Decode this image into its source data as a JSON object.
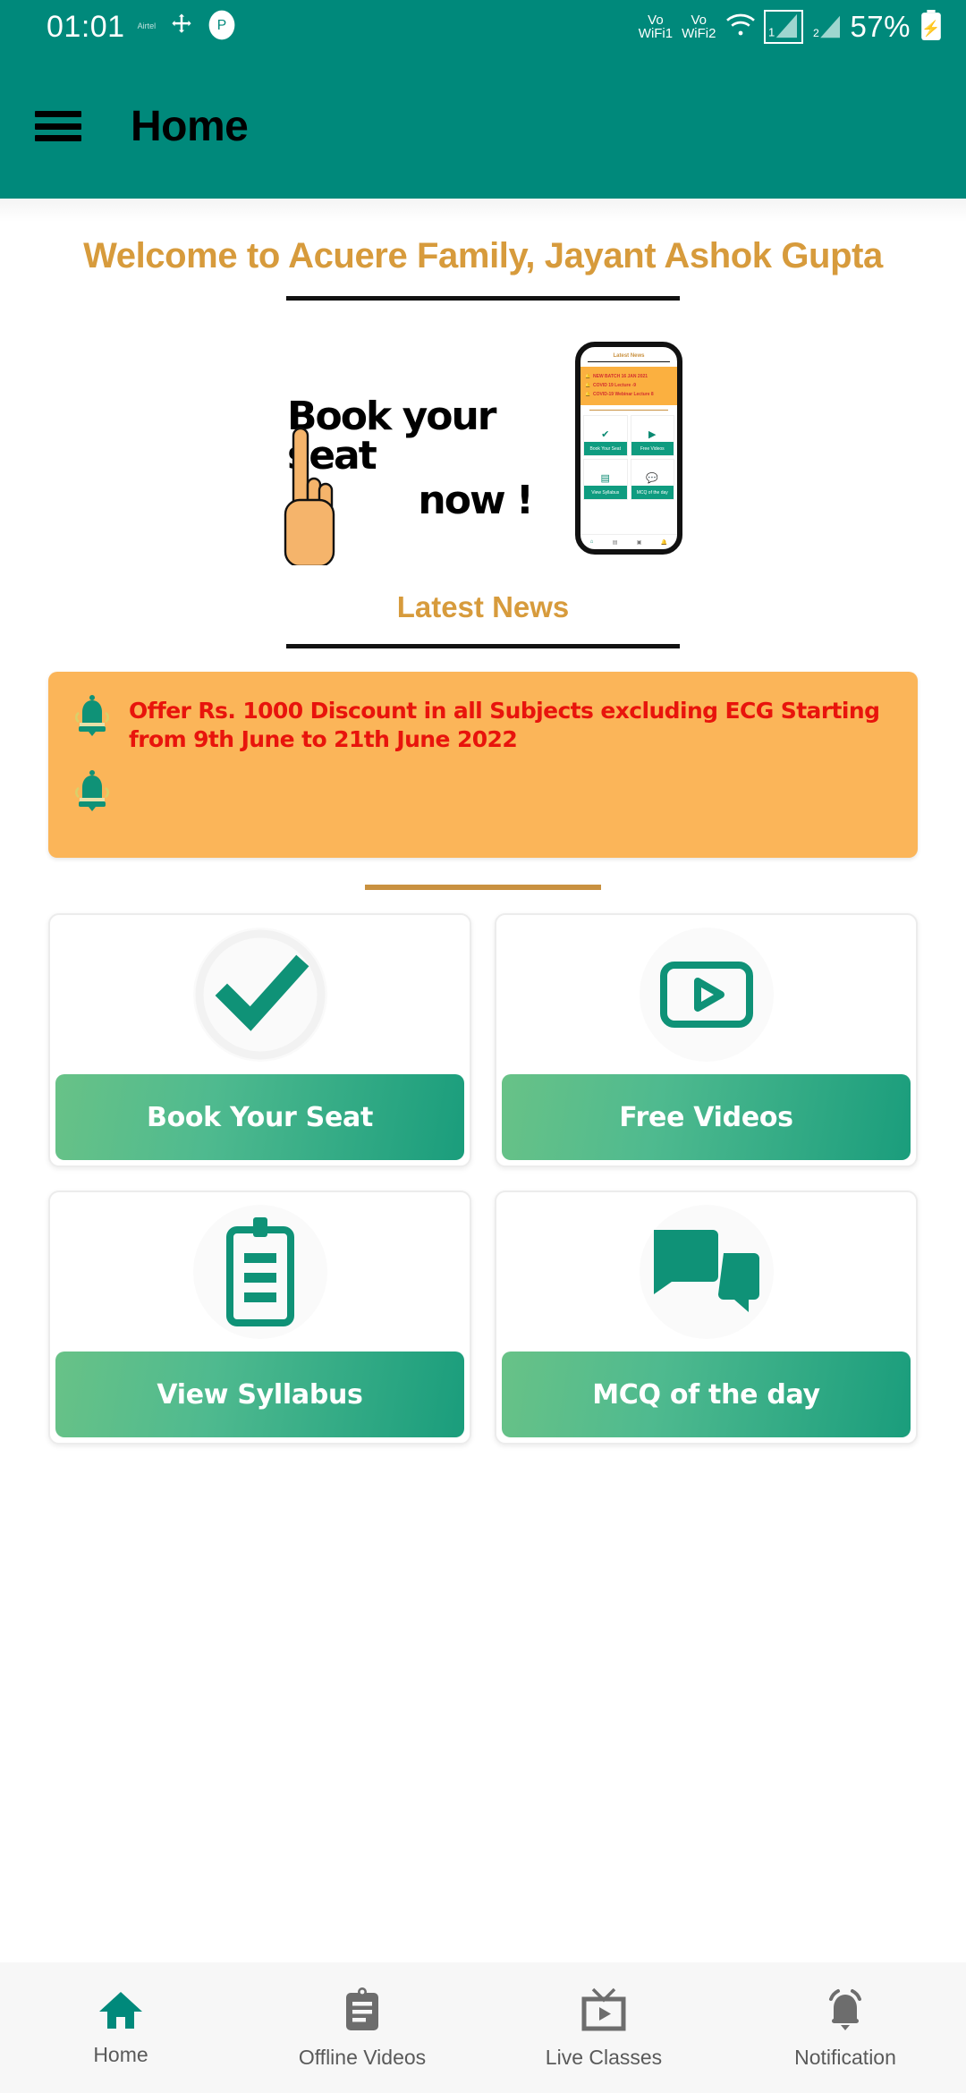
{
  "statusbar": {
    "time": "01:01",
    "carrier_badge": "Airtel",
    "vowifi1": "Vo\nWiFi1",
    "vowifi1_l1": "Vo",
    "vowifi1_l2": "WiFi1",
    "vowifi2_l1": "Vo",
    "vowifi2_l2": "WiFi2",
    "sim1": "1",
    "sim2": "2",
    "battery": "57%",
    "icons": [
      "bluetooth-icon",
      "sync-icon",
      "app-icon",
      "wifi-icon",
      "signal-icon",
      "battery-icon"
    ]
  },
  "appbar": {
    "menu_icon": "hamburger-menu-icon",
    "title": "Home"
  },
  "welcome": {
    "text": "Welcome to Acuere Family, Jayant Ashok Gupta"
  },
  "banner": {
    "line1": "Book your seat",
    "line2": "now !",
    "phone_mock": {
      "title": "Latest News",
      "news": [
        "NEW BATCH 16 JAN 2021",
        "COVID 19 Lecture -9",
        "COVID-19 Webinar Lecture 8"
      ],
      "tiles": [
        "Book Your Seat",
        "Free Videos",
        "View Syllabus",
        "MCQ of the day"
      ],
      "nav": [
        "Home",
        "Offline Videos",
        "Live Classes",
        "Notification"
      ]
    }
  },
  "latest_news": {
    "heading": "Latest News",
    "items": [
      {
        "icon": "bell-icon",
        "text": "Offer Rs. 1000 Discount in all Subjects excluding ECG Starting from 9th June to 21th June 2022"
      },
      {
        "icon": "bell-icon",
        "text": ""
      }
    ]
  },
  "menu_grid": {
    "cards": [
      {
        "icon": "check-mark-icon",
        "label": "Book Your Seat"
      },
      {
        "icon": "video-play-icon",
        "label": "Free Videos"
      },
      {
        "icon": "clipboard-list-icon",
        "label": "View Syllabus"
      },
      {
        "icon": "chat-bubbles-icon",
        "label": "MCQ of the day"
      }
    ]
  },
  "bottom_nav": {
    "items": [
      {
        "icon": "home-icon",
        "label": "Home",
        "active": true
      },
      {
        "icon": "clipboard-icon",
        "label": "Offline Videos",
        "active": false
      },
      {
        "icon": "tv-play-icon",
        "label": "Live Classes",
        "active": false
      },
      {
        "icon": "bell-icon",
        "label": "Notification",
        "active": false
      }
    ]
  },
  "colors": {
    "primary_teal": "#00897B",
    "gold": "#d79b3c",
    "news_bg": "#fbb559",
    "news_text": "#e8140c",
    "icon_teal": "#0f9277"
  }
}
